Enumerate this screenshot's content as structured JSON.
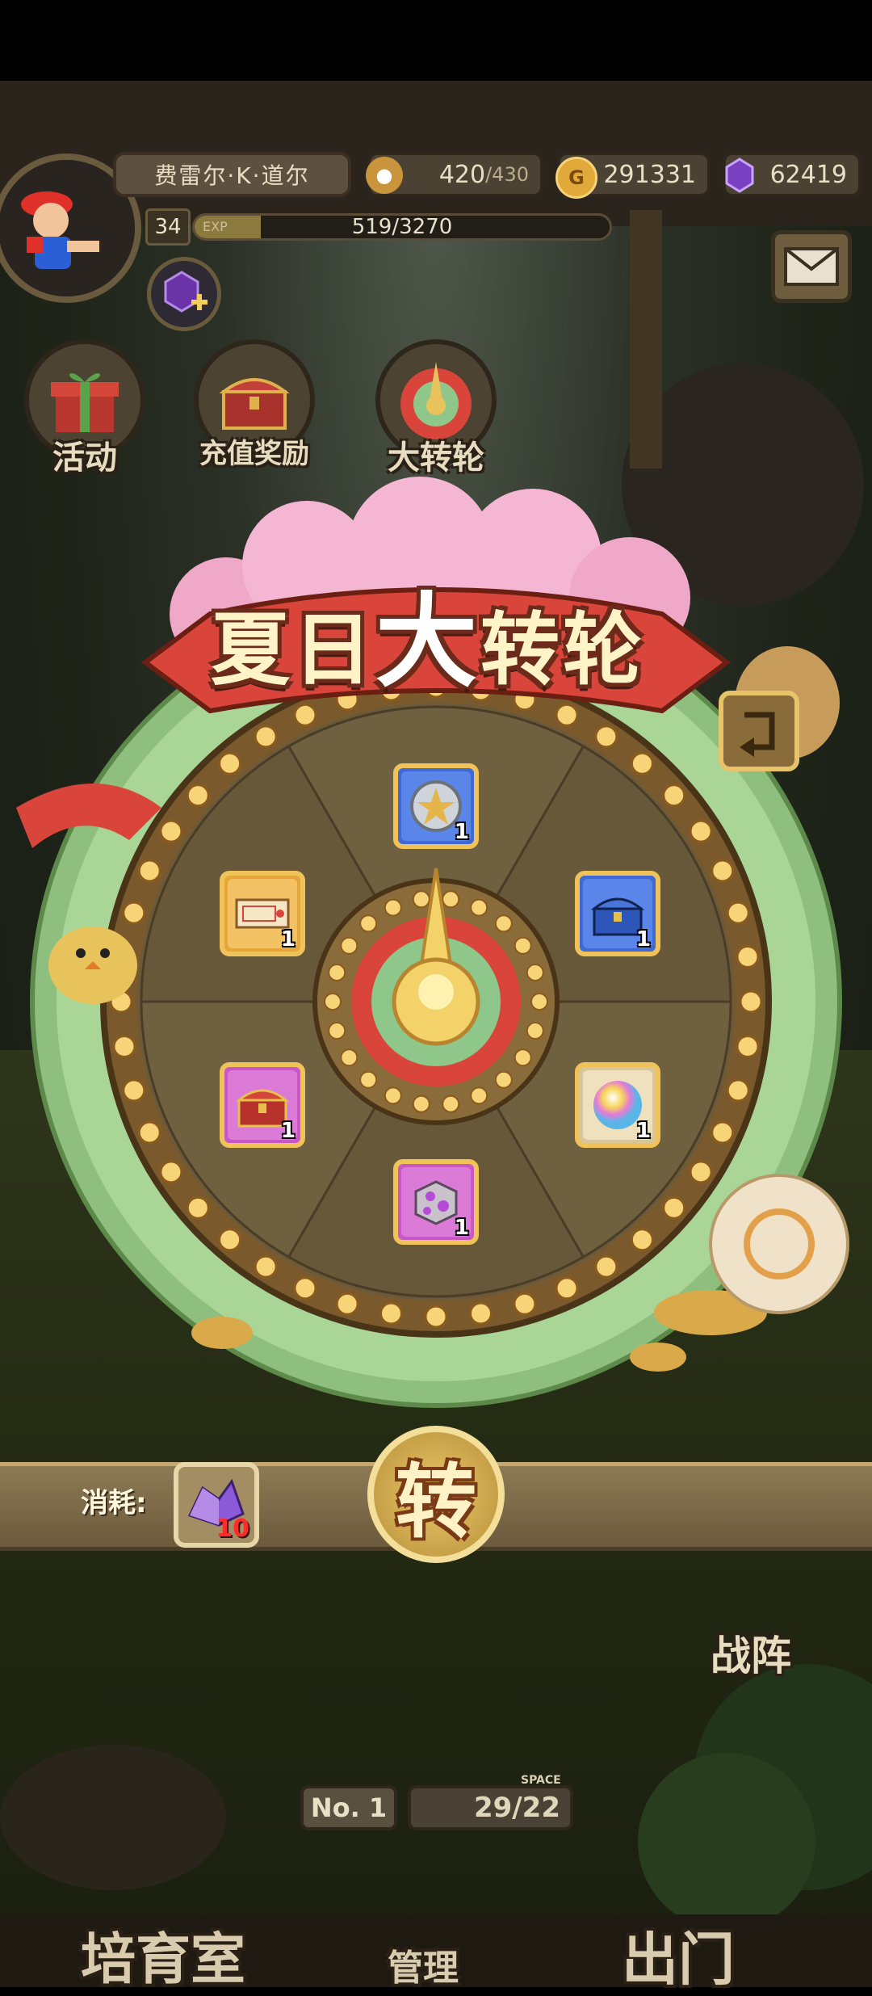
{
  "player": {
    "name": "费雷尔·K·道尔",
    "level": "34",
    "exp_label": "EXP",
    "exp_text": "519/3270",
    "exp_progress": 0.159
  },
  "resources": {
    "stamina": "420",
    "stamina_max": "/430",
    "gold": "291331",
    "gold_icon_letter": "G",
    "gems": "62419"
  },
  "menu": {
    "activity": "活动",
    "recharge_reward": "充值奖励",
    "big_wheel": "大转轮"
  },
  "wheel": {
    "title_part1": "夏日",
    "title_big": "大",
    "title_part2": "转轮",
    "prizes": [
      {
        "name": "silver-medal",
        "count": "1"
      },
      {
        "name": "blue-chest",
        "count": "1"
      },
      {
        "name": "rainbow-orb",
        "count": "1"
      },
      {
        "name": "purple-stone-block",
        "count": "1"
      },
      {
        "name": "red-chest",
        "count": "1"
      },
      {
        "name": "ticket",
        "count": "1"
      }
    ]
  },
  "cost": {
    "label": "消耗:",
    "item_count": "10"
  },
  "spin_button": "转",
  "bottom": {
    "battle": "战阵",
    "rank_prefix": "No. 1",
    "capacity": "29/22",
    "space_label": "SPACE",
    "nursery": "培育室",
    "manage": "管理",
    "go_out": "出门"
  },
  "colors": {
    "gold_accent": "#f0c35a",
    "banner_red": "#d9453a",
    "wheel_green": "#8fc68a"
  }
}
